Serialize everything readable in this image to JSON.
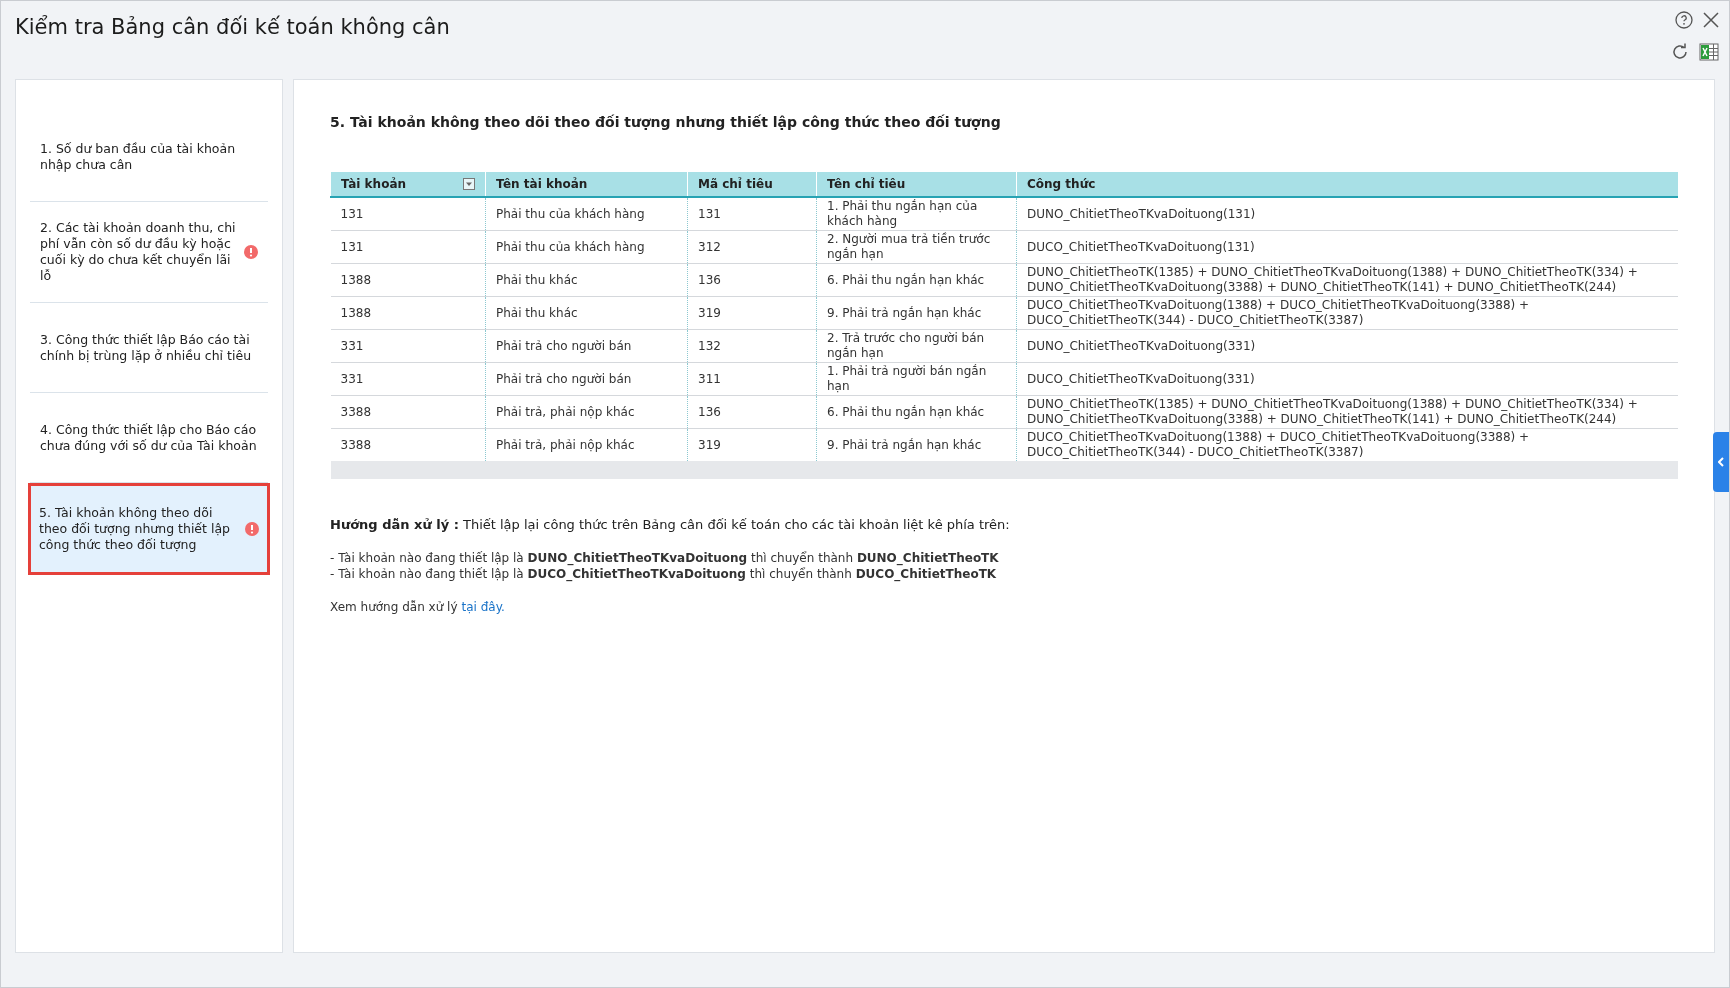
{
  "window": {
    "title": "Kiểm tra Bảng cân đối kế toán không cân"
  },
  "sidebar": {
    "items": [
      {
        "label": "1. Số dư ban đầu của tài khoản nhập chưa cân",
        "alert": false,
        "selected": false
      },
      {
        "label": "2. Các tài khoản doanh thu, chi phí vẫn còn số dư đầu kỳ hoặc cuối kỳ do chưa kết chuyển lãi lỗ",
        "alert": true,
        "selected": false
      },
      {
        "label": "3. Công thức thiết lập Báo cáo tài chính bị trùng lặp ở nhiều chỉ tiêu",
        "alert": false,
        "selected": false
      },
      {
        "label": "4. Công thức thiết lập cho Báo cáo chưa đúng với số dư của Tài khoản",
        "alert": false,
        "selected": false
      },
      {
        "label": "5. Tài khoản không theo dõi theo đối tượng nhưng thiết lập công thức theo đối tượng",
        "alert": true,
        "selected": true
      }
    ]
  },
  "content": {
    "heading": "5. Tài khoản không theo dõi theo đối tượng nhưng thiết lập công thức theo đối tượng",
    "table": {
      "columns": [
        {
          "label": "Tài khoản",
          "filter": true
        },
        {
          "label": "Tên tài khoản",
          "filter": false
        },
        {
          "label": "Mã chỉ tiêu",
          "filter": false
        },
        {
          "label": "Tên chỉ tiêu",
          "filter": false
        },
        {
          "label": "Công thức",
          "filter": false
        }
      ],
      "rows": [
        [
          "131",
          "Phải thu của khách hàng",
          "131",
          "1. Phải thu ngắn hạn của khách hàng",
          "DUNO_ChitietTheoTKvaDoituong(131)"
        ],
        [
          "131",
          "Phải thu của khách hàng",
          "312",
          "2. Người mua trả tiền trước ngắn hạn",
          "DUCO_ChitietTheoTKvaDoituong(131)"
        ],
        [
          "1388",
          "Phải thu khác",
          "136",
          "6. Phải thu ngắn hạn khác",
          "DUNO_ChitietTheoTK(1385) + DUNO_ChitietTheoTKvaDoituong(1388) + DUNO_ChitietTheoTK(334) + DUNO_ChitietTheoTKvaDoituong(3388) + DUNO_ChitietTheoTK(141) + DUNO_ChitietTheoTK(244)"
        ],
        [
          "1388",
          "Phải thu khác",
          "319",
          "9. Phải trả ngắn hạn khác",
          "DUCO_ChitietTheoTKvaDoituong(1388) + DUCO_ChitietTheoTKvaDoituong(3388) + DUCO_ChitietTheoTK(344) - DUCO_ChitietTheoTK(3387)"
        ],
        [
          "331",
          "Phải trả cho người bán",
          "132",
          "2. Trả trước cho người bán ngắn hạn",
          "DUNO_ChitietTheoTKvaDoituong(331)"
        ],
        [
          "331",
          "Phải trả cho người bán",
          "311",
          "1. Phải trả người bán ngắn hạn",
          "DUCO_ChitietTheoTKvaDoituong(331)"
        ],
        [
          "3388",
          "Phải trả, phải nộp khác",
          "136",
          "6. Phải thu ngắn hạn khác",
          "DUNO_ChitietTheoTK(1385) + DUNO_ChitietTheoTKvaDoituong(1388) + DUNO_ChitietTheoTK(334) + DUNO_ChitietTheoTKvaDoituong(3388) + DUNO_ChitietTheoTK(141) + DUNO_ChitietTheoTK(244)"
        ],
        [
          "3388",
          "Phải trả, phải nộp khác",
          "319",
          "9. Phải trả ngắn hạn khác",
          "DUCO_ChitietTheoTKvaDoituong(1388) + DUCO_ChitietTheoTKvaDoituong(3388) + DUCO_ChitietTheoTK(344) - DUCO_ChitietTheoTK(3387)"
        ]
      ]
    },
    "guide": "**Hướng dẫn xử lý :** Thiết lập lại công thức trên Bảng cân đối kế toán cho các tài khoản liệt kê phía trên:",
    "guide_lines": [
      "- Tài khoản nào đang thiết lập là **DUNO_ChitietTheoTKvaDoituong** thì chuyển thành **DUNO_ChitietTheoTK**",
      "- Tài khoản nào đang thiết lập là **DUCO_ChitietTheoTKvaDoituong** thì chuyển thành **DUCO_ChitietTheoTK**"
    ],
    "see_more": "Xem hướng dẫn xử lý",
    "link": "tại đây."
  }
}
